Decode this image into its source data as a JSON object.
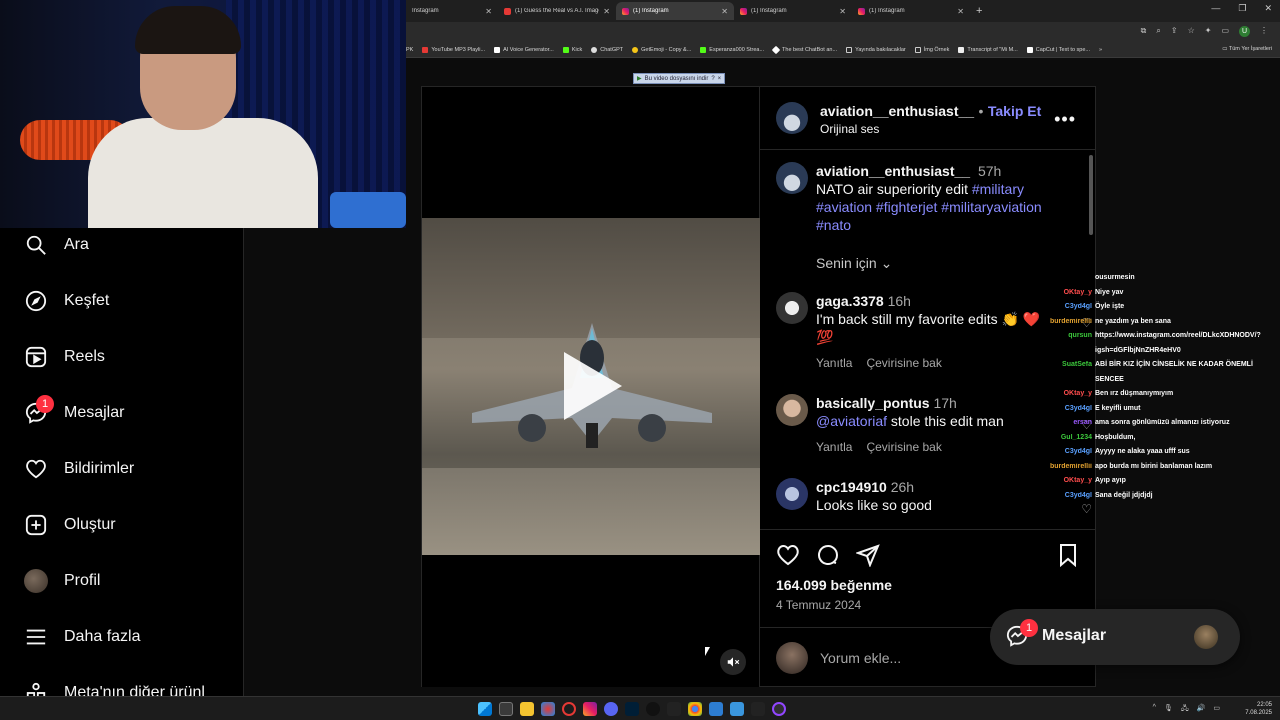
{
  "browser": {
    "tabs": [
      {
        "label": "Instagram",
        "active": false,
        "icon": "instagram-icon"
      },
      {
        "label": "(1) Guess the Real vs A.I. Image",
        "active": false,
        "icon": "youtube-icon"
      },
      {
        "label": "(1) Instagram",
        "active": true,
        "icon": "instagram-icon"
      },
      {
        "label": "(1) Instagram",
        "active": false,
        "icon": "instagram-icon"
      },
      {
        "label": "(1) Instagram",
        "active": false,
        "icon": "instagram-icon"
      }
    ],
    "new_tab": "+",
    "profile_initial": "U",
    "bookmarks": [
      "PK",
      "YouTube MP3 Playli...",
      "AI Voice Generator...",
      "Kick",
      "ChatGPT",
      "GetEmoji - Copy &...",
      "Esperanza000 Strea...",
      "The best ChatBot an...",
      "Yayında bakılacaklar",
      "İmg Örnek",
      "Transcript of \"Mi M...",
      "CapCut | Text to spe..."
    ],
    "bookmarks_overflow": "»",
    "all_bookmarks": "Tüm Yer İşaretleri"
  },
  "download_bar": {
    "label": "Bu video dosyasını indir",
    "help": "?",
    "close": "×"
  },
  "sidenav": {
    "items": [
      {
        "label": "Ara",
        "icon": "search-icon"
      },
      {
        "label": "Keşfet",
        "icon": "compass-icon"
      },
      {
        "label": "Reels",
        "icon": "reels-icon"
      },
      {
        "label": "Mesajlar",
        "icon": "messenger-icon",
        "badge": "1"
      },
      {
        "label": "Bildirimler",
        "icon": "heart-icon"
      },
      {
        "label": "Oluştur",
        "icon": "plus-square-icon"
      },
      {
        "label": "Profil",
        "icon": "avatar"
      },
      {
        "label": "Daha fazla",
        "icon": "menu-icon"
      },
      {
        "label": "Meta'nın diğer ürünl",
        "icon": "meta-icon"
      }
    ]
  },
  "post": {
    "author": "aviation__enthusiast__",
    "separator": "•",
    "follow_label": "Takip Et",
    "audio": "Orijinal ses",
    "more": "•••",
    "caption": {
      "author": "aviation__enthusiast__",
      "time": "57h",
      "text": "NATO air superiority edit",
      "hashtags_line1": "#military",
      "hashtags_line2": "#aviation #fighterjet #militaryaviation",
      "hashtags_line3": "#nato"
    },
    "for_you": "Senin için",
    "comments": [
      {
        "user": "gaga.3378",
        "time": "16h",
        "text": "I'm back still my favorite edits 👏 ❤️",
        "extra": "💯",
        "reply": "Yanıtla",
        "translate": "Çevirisine bak"
      },
      {
        "user": "basically_pontus",
        "time": "17h",
        "mention": "@aviatoriaf",
        "text": "stole this edit man",
        "reply": "Yanıtla",
        "translate": "Çevirisine bak"
      },
      {
        "user": "cpc194910",
        "time": "26h",
        "text": "Looks like so good"
      }
    ],
    "likes": "164.099 beğenme",
    "date": "4 Temmuz 2024",
    "comment_placeholder": "Yorum ekle..."
  },
  "chat": {
    "lines": [
      {
        "user": "",
        "msg": "ousurmesin",
        "color": "#ffffff"
      },
      {
        "user": "OKtay_y",
        "msg": "Niye yav",
        "color": "#ff4d4d"
      },
      {
        "user": "C3yd4gl",
        "msg": "Öyle işte",
        "color": "#5aa0ff"
      },
      {
        "user": "burdemirellii",
        "msg": "ne yazdım ya ben sana",
        "color": "#e0a030"
      },
      {
        "user": "qursun",
        "msg": "https://www.instagram.com/reel/DLkcXDHNODV/?",
        "color": "#3cc83c"
      },
      {
        "user": "",
        "msg": "igsh=dGFlbjNnZHR4eHV0",
        "color": "#ffffff"
      },
      {
        "user": "SuatSefa",
        "msg": "ABİ BİR KIZ İÇİN CİNSELİK NE KADAR ÖNEMLİ",
        "color": "#3cc83c"
      },
      {
        "user": "",
        "msg": "SENCEE",
        "color": "#ffffff"
      },
      {
        "user": "OKtay_y",
        "msg": "Ben ırz düşmanıymıyım",
        "color": "#ff4d4d"
      },
      {
        "user": "C3yd4gl",
        "msg": "E keyifli umut",
        "color": "#5aa0ff"
      },
      {
        "user": "ersan",
        "msg": "ama sonra gönlümüzü almanızı istiyoruz",
        "color": "#9b59ff"
      },
      {
        "user": "Gul_1234",
        "msg": "Hoşbuldum,",
        "color": "#3cc83c"
      },
      {
        "user": "C3yd4gl",
        "msg": "Ayyyy ne alaka yaaa ufff sus",
        "color": "#5aa0ff"
      },
      {
        "user": "burdemirellii",
        "msg": "apo burda mı birini banlaman lazım",
        "color": "#e0a030"
      },
      {
        "user": "OKtay_y",
        "msg": "Ayıp ayıp",
        "color": "#ff4d4d"
      },
      {
        "user": "C3yd4gl",
        "msg": "Sana değil jdjdjdj",
        "color": "#5aa0ff"
      }
    ]
  },
  "messages_float": {
    "label": "Mesajlar",
    "badge": "1"
  },
  "taskbar": {
    "time": "22:05",
    "date": "7.08.2025",
    "tray_up": "^"
  },
  "colors": {
    "link": "#8a8cff",
    "badge": "#ff3040",
    "bg": "#000000"
  }
}
